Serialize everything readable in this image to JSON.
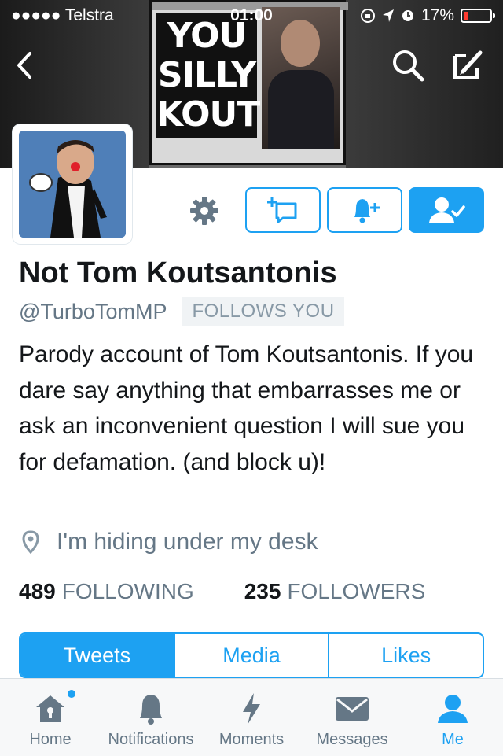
{
  "status_bar": {
    "carrier": "●●●●● Telstra",
    "time": "01:00",
    "battery": "17%",
    "battery_level": 0.17
  },
  "banner": {
    "headline": "YOU SILLY KOUT"
  },
  "header": {
    "back_icon": "chevron-left-icon",
    "search_icon": "search-icon",
    "compose_icon": "compose-icon"
  },
  "profile": {
    "name": "Not Tom Koutsantonis",
    "handle": "@TurboTomMP",
    "follows_badge": "FOLLOWS YOU",
    "bio": "Parody account of Tom Koutsantonis. If you dare say anything that embarrasses me or ask an inconvenient question I will sue you for defamation. (and block u)!",
    "location": "I'm hiding under my desk",
    "following_count": "489",
    "following_label": "FOLLOWING",
    "followers_count": "235",
    "followers_label": "FOLLOWERS"
  },
  "actions": {
    "settings_icon": "gear-icon",
    "list_icon": "add-to-list-icon",
    "notify_icon": "bell-plus-icon",
    "following_icon": "user-check-icon"
  },
  "tabs": [
    {
      "label": "Tweets",
      "active": true
    },
    {
      "label": "Media",
      "active": false
    },
    {
      "label": "Likes",
      "active": false
    }
  ],
  "tabbar": [
    {
      "label": "Home",
      "icon": "home-icon",
      "active": false
    },
    {
      "label": "Notifications",
      "icon": "bell-icon",
      "active": false
    },
    {
      "label": "Moments",
      "icon": "lightning-icon",
      "active": false
    },
    {
      "label": "Messages",
      "icon": "envelope-icon",
      "active": false
    },
    {
      "label": "Me",
      "icon": "person-icon",
      "active": true
    }
  ],
  "colors": {
    "accent": "#1da1f2",
    "muted": "#657786",
    "text": "#14171a"
  }
}
